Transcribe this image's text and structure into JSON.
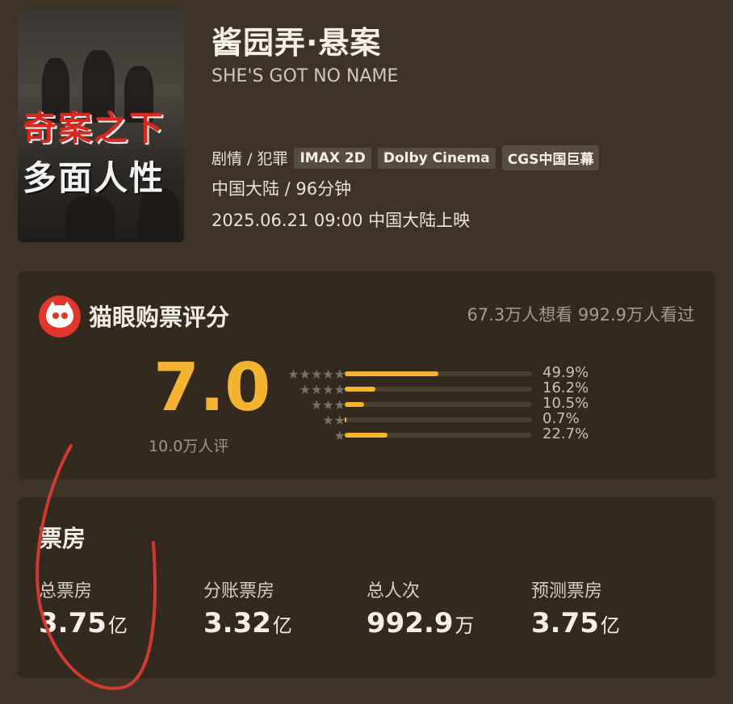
{
  "movie": {
    "title": "酱园弄·悬案",
    "subtitle": "SHE'S GOT NO NAME",
    "genre": "剧情 / 犯罪",
    "tags": [
      "IMAX 2D",
      "Dolby Cinema",
      "CGS中国巨幕"
    ],
    "region_duration": "中国大陆 / 96分钟",
    "release": "2025.06.21 09:00 中国大陆上映",
    "poster": {
      "line1": "奇案之下",
      "line2": "多面人性"
    }
  },
  "rating": {
    "title": "猫眼购票评分",
    "want_watched": "67.3万人想看 992.9万人看过",
    "score": "7.0",
    "count": "10.0万人评",
    "distribution": [
      {
        "stars": "★★★★★",
        "percent_label": "49.9%",
        "percent": 49.9
      },
      {
        "stars": "★★★★",
        "percent_label": "16.2%",
        "percent": 16.2
      },
      {
        "stars": "★★★",
        "percent_label": "10.5%",
        "percent": 10.5
      },
      {
        "stars": "★★",
        "percent_label": "0.7%",
        "percent": 0.7
      },
      {
        "stars": "★",
        "percent_label": "22.7%",
        "percent": 22.7
      }
    ],
    "accent_color": "#f4b330"
  },
  "box_office": {
    "title": "票房",
    "stats": [
      {
        "label": "总票房",
        "value": "3.75",
        "unit": "亿"
      },
      {
        "label": "分账票房",
        "value": "3.32",
        "unit": "亿"
      },
      {
        "label": "总人次",
        "value": "992.9",
        "unit": "万"
      },
      {
        "label": "预测票房",
        "value": "3.75",
        "unit": "亿"
      }
    ]
  },
  "annotation_color": "#d23a2f"
}
